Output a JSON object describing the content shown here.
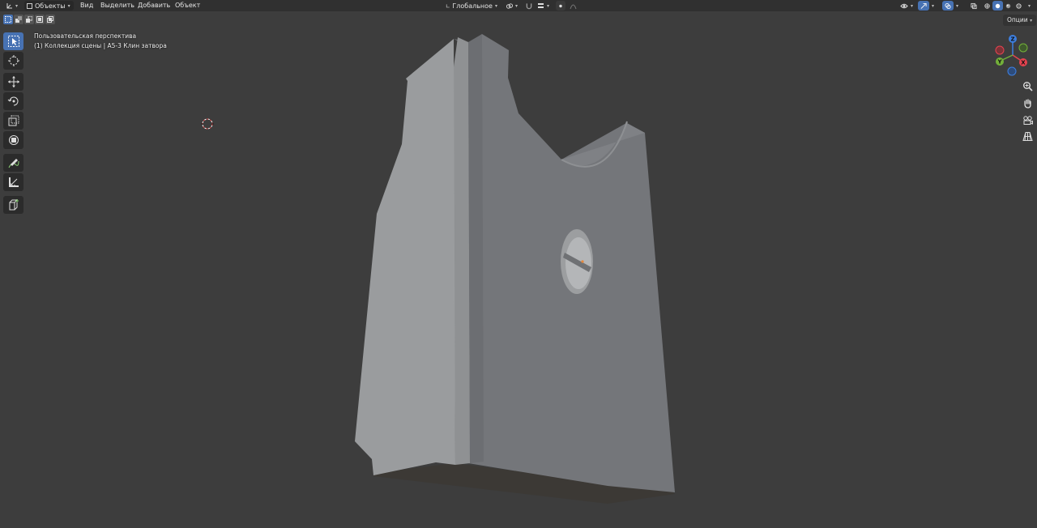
{
  "header": {
    "editor_type_icon": "object-axes-icon",
    "mode": "Объекты",
    "menu": {
      "view": "Вид",
      "select": "Выделить",
      "add": "Добавить",
      "object": "Объект"
    },
    "orientation": "Глобальное",
    "pivot_icon": "pivot-icon",
    "snap_icon": "magnet-icon",
    "proportional_icon": "proportional-edit-icon",
    "visibility_icon": "eye-visibility-icon",
    "gizmo_icon": "gizmo-icon",
    "overlay_icon": "overlay-icon",
    "xray_icon": "xray-icon",
    "shading_modes": [
      "wireframe-icon",
      "solid-icon",
      "material-preview-icon",
      "rendered-icon"
    ]
  },
  "select_modes": [
    "select-new",
    "select-extend",
    "select-subtract",
    "select-invert",
    "select-intersect"
  ],
  "toolbar": [
    {
      "name": "select-box-tool",
      "icon": "cursor-arrow-icon",
      "active": true
    },
    {
      "name": "cursor-tool",
      "icon": "3d-cursor-icon",
      "active": false
    },
    {
      "name": "move-tool",
      "icon": "move-arrows-icon",
      "active": false
    },
    {
      "name": "rotate-tool",
      "icon": "rotate-icon",
      "active": false
    },
    {
      "name": "scale-tool",
      "icon": "scale-icon",
      "active": false
    },
    {
      "name": "transform-tool",
      "icon": "transform-icon",
      "active": false
    },
    {
      "name": "annotate-tool",
      "icon": "pencil-icon",
      "active": false
    },
    {
      "name": "measure-tool",
      "icon": "ruler-icon",
      "active": false
    },
    {
      "name": "add-cube-tool",
      "icon": "add-cube-icon",
      "active": false
    }
  ],
  "viewport": {
    "view_name": "Пользовательская перспектива",
    "collection_line": "(1) Коллекция сцены | А5-3 Клин затвора",
    "options_label": "Опции"
  },
  "nav_gizmo": {
    "axes": {
      "x": "X",
      "y": "Y",
      "z": "Z"
    },
    "colors": {
      "x": "#e5434f",
      "y": "#73b03a",
      "z": "#3d7fe0"
    }
  },
  "nav_buttons": [
    "zoom-icon",
    "hand-pan-icon",
    "camera-icon",
    "grid-perspective-icon"
  ]
}
